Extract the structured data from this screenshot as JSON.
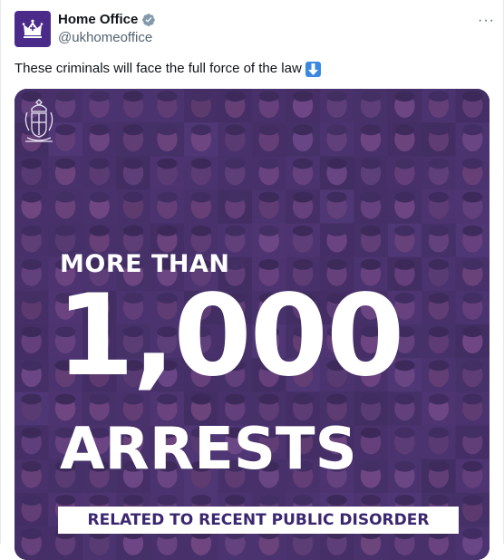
{
  "tweet": {
    "author": {
      "display_name": "Home Office",
      "handle": "@ukhomeoffice",
      "verified": true,
      "avatar_icon": "royal-crown-icon",
      "avatar_color": "#4b2b8a"
    },
    "more_icon": "···",
    "text": "These criminals will face the full force of the law",
    "emoji_icon": "down-arrow-emoji-icon",
    "media": {
      "crest_icon": "royal-coat-of-arms-icon",
      "headline_top": "MORE THAN",
      "headline_number": "1,000",
      "headline_bottom": "ARRESTS",
      "banner": "RELATED TO RECENT PUBLIC DISORDER",
      "background_color": "#4a3273",
      "banner_text_color": "#3b2770"
    }
  }
}
